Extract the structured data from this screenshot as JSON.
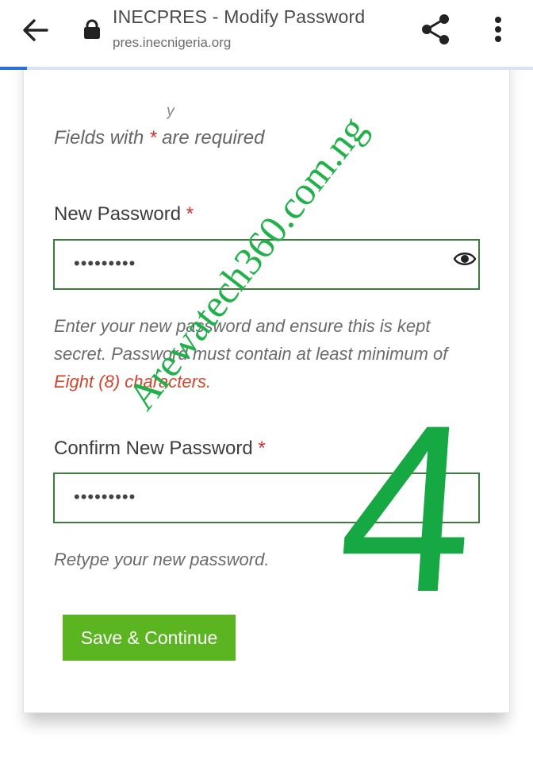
{
  "browser": {
    "title": "INECPRES - Modify Password",
    "url": "pres.inecnigeria.org",
    "load_progress": 0.05,
    "back_icon": "arrow-left-icon",
    "lock_icon": "lock-icon",
    "share_icon": "share-icon",
    "more_icon": "more-vert-icon",
    "accent_color": "#2a6fdb"
  },
  "form": {
    "peek_text": "y",
    "required_note": {
      "prefix": "Fields with",
      "star": "*",
      "suffix": "are required"
    },
    "new_password": {
      "label": "New Password",
      "star": "*",
      "value": "•••••••••",
      "toggle_icon": "eye-icon",
      "help_line1": "Enter your new password and ensure this is kept",
      "help_line2": "secret. Password must contain at least minimum of",
      "help_highlight": "Eight (8) characters."
    },
    "confirm_password": {
      "label": "Confirm New Password",
      "star": "*",
      "value": "•••••••••",
      "help": "Retype your new password."
    },
    "save_button": "Save & Continue",
    "input_border_color": "#3e7c3e",
    "button_color": "#5bb521",
    "required_color": "#c9302c"
  },
  "watermark": {
    "site": "Arewatech360.com.ng",
    "step": "4",
    "color": "#16a843"
  }
}
